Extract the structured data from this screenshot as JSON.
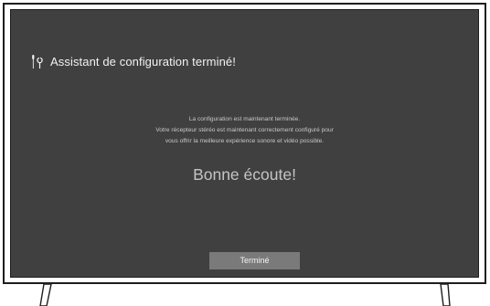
{
  "dialog": {
    "title": "Assistant de configuration terminé!",
    "icon": "wrench-screwdriver-icon",
    "message_lines": [
      "La configuration est maintenant terminée.",
      "Votre récepteur stéréo est maintenant correctement configuré pour",
      "vous offrir la meilleure expérience sonore et vidéo possible."
    ],
    "enjoy_text": "Bonne écoute!",
    "done_button_label": "Terminé"
  },
  "colors": {
    "screen_background": "#404040",
    "title_text": "#f2f2f2",
    "body_text": "#c8c8c8",
    "button_background": "#7a7a7a",
    "frame": "#1e1e1e"
  }
}
